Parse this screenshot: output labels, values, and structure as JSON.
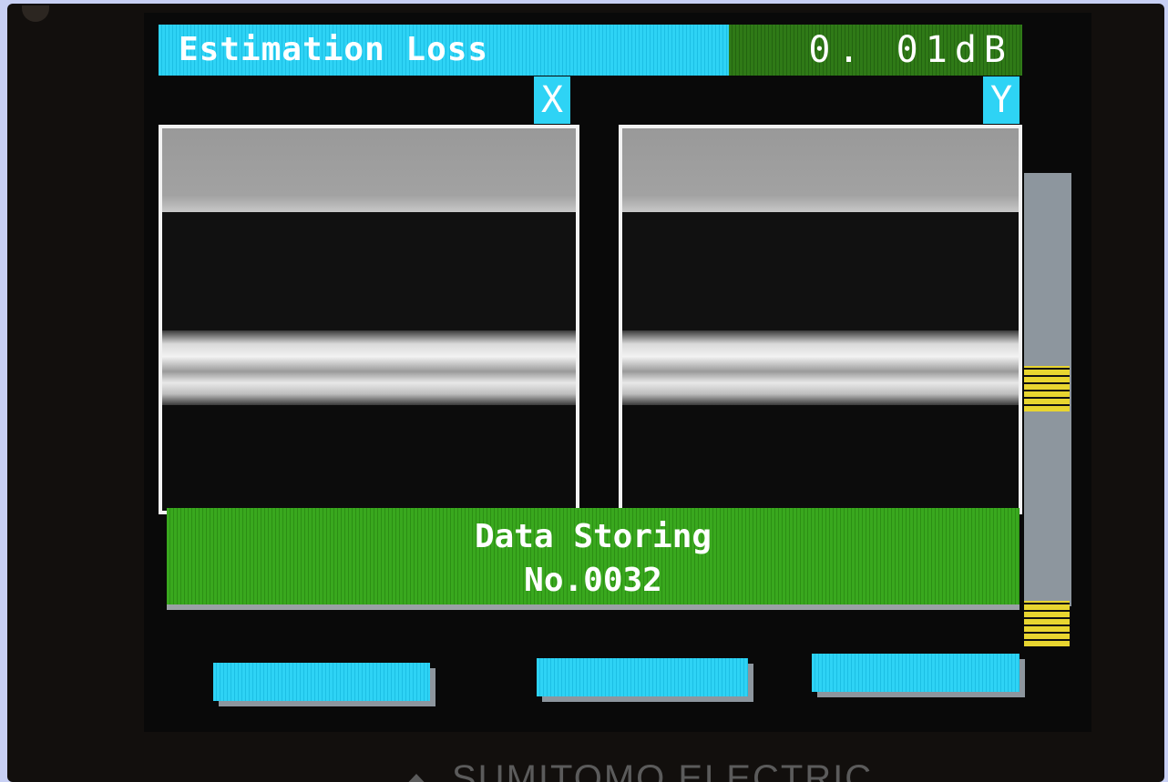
{
  "header": {
    "title": "Estimation Loss",
    "loss_value": "0. 01dB"
  },
  "views": [
    {
      "label": "X"
    },
    {
      "label": "Y"
    }
  ],
  "status": {
    "line1": "Data Storing",
    "line2": "No.0032"
  },
  "soft_keys": [
    {
      "label": ""
    },
    {
      "label": ""
    },
    {
      "label": ""
    }
  ],
  "brand": "SUMITOMO ELECTRIC",
  "colors": {
    "header_cyan": "#2ed3f5",
    "loss_green": "#2f7a17",
    "status_green": "#39a81e",
    "marker_yellow": "#e8d530"
  }
}
